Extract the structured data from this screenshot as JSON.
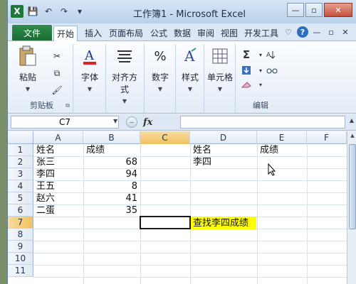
{
  "title": "工作簿1 - Microsoft Excel",
  "qat": {
    "logo": "X",
    "save": "💾",
    "undo": "↶",
    "redo": "↷",
    "more": "▾"
  },
  "window_buttons": {
    "minimize": "—",
    "restore": "▫",
    "close": "✕"
  },
  "tabs": [
    "文件",
    "开始",
    "插入",
    "页面布局",
    "公式",
    "数据",
    "审阅",
    "视图",
    "开发工具"
  ],
  "tab_icons": {
    "up": "♡",
    "help": "?",
    "min": "—",
    "restore": "▫",
    "close": "✕"
  },
  "ribbon": {
    "paste": "粘贴",
    "clipboard_group": "剪贴板",
    "font": "字体",
    "align": "对齐方式",
    "number": "数字",
    "styles": "样式",
    "cells": "单元格",
    "editing_group": "编辑",
    "sigma": "Σ",
    "launcher": "⧉"
  },
  "name_box": "C7",
  "fx": "fx",
  "columns": [
    "A",
    "B",
    "C",
    "D",
    "E",
    "F"
  ],
  "rows": [
    "1",
    "2",
    "3",
    "4",
    "5",
    "6",
    "7",
    "8",
    "9",
    "10",
    "11"
  ],
  "cells": {
    "A1": "姓名",
    "B1": "成绩",
    "A2": "张三",
    "B2": "68",
    "A3": "李四",
    "B3": "94",
    "A4": "王五",
    "B4": "8",
    "A5": "赵六",
    "B5": "41",
    "A6": "二蛋",
    "B6": "35",
    "D1": "姓名",
    "E1": "成绩",
    "D2": "李四",
    "D7": "查找李四成绩"
  },
  "colors": {
    "accent": "#1f7a3a",
    "highlight": "#ffff00"
  }
}
